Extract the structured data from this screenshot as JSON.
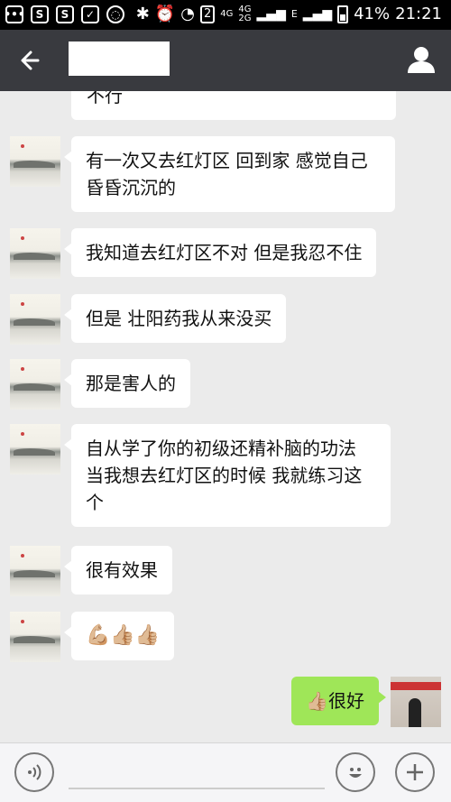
{
  "status_bar": {
    "left_icons": [
      "chat-icon",
      "sim-icon",
      "s-app-icon",
      "clipboard-icon",
      "refresh-icon"
    ],
    "sim_slot": "2",
    "network_a": "4G",
    "network_b": "4G",
    "network_c": "2G",
    "edge": "E",
    "battery": "41%",
    "time": "21:21"
  },
  "header": {
    "back_icon": "back-arrow-icon",
    "contact_name": "",
    "profile_icon": "profile-icon"
  },
  "messages": [
    {
      "from": "other",
      "text": "不行"
    },
    {
      "from": "other",
      "lines": [
        "有一次又去红灯区 回到家 感觉自己",
        "昏昏沉沉的"
      ]
    },
    {
      "from": "other",
      "text": "我知道去红灯区不对 但是我忍不住"
    },
    {
      "from": "other",
      "text": "但是 壮阳药我从来没买"
    },
    {
      "from": "other",
      "text": "那是害人的"
    },
    {
      "from": "other",
      "lines": [
        "自从学了你的初级还精补脑的功法",
        "当我想去红灯区的时候 我就练习这",
        "个"
      ]
    },
    {
      "from": "other",
      "text": "很有效果"
    },
    {
      "from": "other",
      "text": "💪🏼👍🏼👍🏼"
    },
    {
      "from": "self",
      "text": "👍🏼很好"
    }
  ],
  "input_bar": {
    "voice_icon": "voice-icon",
    "emoji_icon": "emoji-icon",
    "plus_icon": "plus-icon"
  },
  "colors": {
    "status_bar": "#000000",
    "title_bar": "#393a3f",
    "chat_bg": "#ebebeb",
    "received_bubble": "#ffffff",
    "sent_bubble": "#9fe658"
  }
}
